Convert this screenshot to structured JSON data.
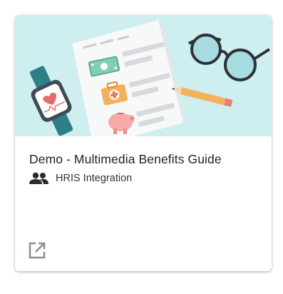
{
  "card": {
    "title": "Demo - Multimedia Benefits Guide",
    "category_icon": "people-icon",
    "category": "HRIS Integration",
    "action_icon": "open-in-new-icon",
    "banner_color": "#cfeef0"
  }
}
